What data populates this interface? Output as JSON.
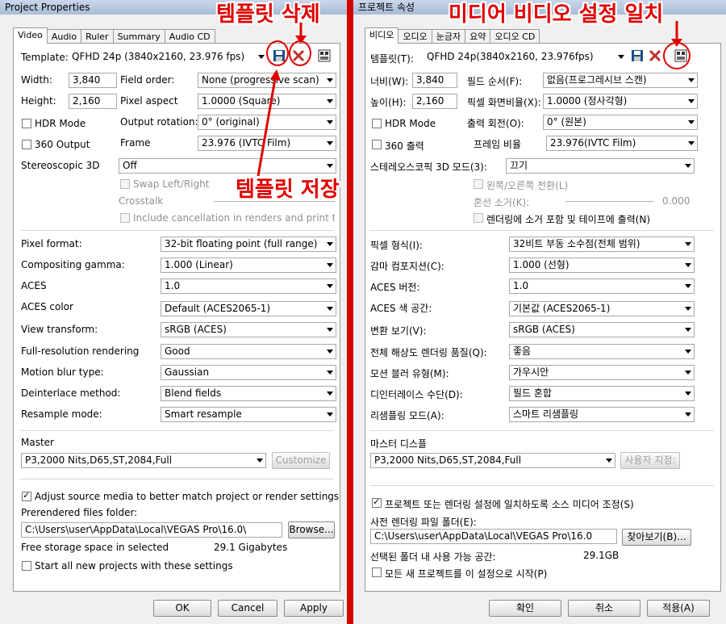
{
  "left": {
    "title": "Project Properties",
    "tabs": [
      "Video",
      "Audio",
      "Ruler",
      "Summary",
      "Audio CD"
    ],
    "template": {
      "label": "Template:",
      "value": "QFHD 24p (3840x2160, 23.976 fps)"
    },
    "width": {
      "label": "Width:",
      "value": "3,840"
    },
    "height": {
      "label": "Height:",
      "value": "2,160"
    },
    "field_order": {
      "label": "Field order:",
      "value": "None (progressive scan)"
    },
    "pixel_aspect": {
      "label": "Pixel aspect",
      "value": "1.0000 (Square)"
    },
    "output_rotation": {
      "label": "Output rotation:",
      "value": "0° (original)"
    },
    "hdr": "HDR Mode",
    "three60": "360 Output",
    "frame": {
      "label": "Frame",
      "value": "23.976 (IVTC Film)"
    },
    "stereo": {
      "label": "Stereoscopic 3D",
      "value": "Off"
    },
    "swap": "Swap Left/Right",
    "crosstalk": "Crosstalk",
    "include_cancel": "Include cancellation in renders and print to ta",
    "pixel_format": {
      "label": "Pixel format:",
      "value": "32-bit floating point (full range)"
    },
    "compositing": {
      "label": "Compositing gamma:",
      "value": "1.000 (Linear)"
    },
    "aces": {
      "label": "ACES",
      "value": "1.0"
    },
    "aces_color": {
      "label": "ACES color",
      "value": "Default (ACES2065-1)"
    },
    "view_transform": {
      "label": "View transform:",
      "value": "sRGB (ACES)"
    },
    "full_res": {
      "label": "Full-resolution rendering",
      "value": "Good"
    },
    "motion_blur": {
      "label": "Motion blur type:",
      "value": "Gaussian"
    },
    "deinterlace": {
      "label": "Deinterlace method:",
      "value": "Blend fields"
    },
    "resample": {
      "label": "Resample mode:",
      "value": "Smart resample"
    },
    "master": {
      "label": "Master",
      "value": "P3,2000 Nits,D65,ST,2084,Full",
      "customize": "Customize"
    },
    "adjust": "Adjust source media to better match project or render settings",
    "prerendered": {
      "label": "Prerendered files folder:",
      "value": "C:\\Users\\user\\AppData\\Local\\VEGAS Pro\\16.0\\",
      "browse": "Browse..."
    },
    "free_space": {
      "label": "Free storage space in selected",
      "value": "29.1 Gigabytes"
    },
    "start_all": "Start all new projects with these settings",
    "ok": "OK",
    "cancel": "Cancel",
    "apply": "Apply"
  },
  "right": {
    "title": "프로젝트 속성",
    "tabs": [
      "비디오",
      "오디오",
      "눈금자",
      "요약",
      "오디오 CD"
    ],
    "template": {
      "label": "템플릿(T):",
      "value": "QFHD 24p(3840x2160, 23.976fps)"
    },
    "width": {
      "label": "너비(W):",
      "value": "3,840"
    },
    "height": {
      "label": "높이(H):",
      "value": "2,160"
    },
    "field_order": {
      "label": "필드 순서(F):",
      "value": "없음(프로그레시브 스캔)"
    },
    "pixel_aspect": {
      "label": "픽셀 화면비율(X):",
      "value": "1.0000 (정사각형)"
    },
    "output_rotation": {
      "label": "출력 회전(O):",
      "value": "0°  (원본)"
    },
    "hdr": "HDR Mode",
    "three60": "360 출력",
    "frame": {
      "label": "프레임 비율",
      "value": "23.976(IVTC Film)"
    },
    "stereo": {
      "label": "스테레오스코픽 3D 모드(3):",
      "value": "끄기"
    },
    "swap": "왼쪽/오른쪽 전환(L)",
    "crosstalk": "혼선 소거(K):",
    "crosstalk_value": "0.000",
    "include_cancel": "렌더링에 소거 포함 및 테이프에 출력(N)",
    "pixel_format": {
      "label": "픽셀 형식(I):",
      "value": "32비트 부동 소수점(전체 범위)"
    },
    "compositing": {
      "label": "감마 컴포지션(C):",
      "value": "1.000 (선형)"
    },
    "aces": {
      "label": "ACES 버전:",
      "value": "1.0"
    },
    "aces_color": {
      "label": "ACES 색 공간:",
      "value": "기본값 (ACES2065-1)"
    },
    "view_transform": {
      "label": "변환 보기(V):",
      "value": "sRGB (ACES)"
    },
    "full_res": {
      "label": "전체 해상도 렌더링 품질(Q):",
      "value": "좋음"
    },
    "motion_blur": {
      "label": "모션 블러 유형(M):",
      "value": "가우시안"
    },
    "deinterlace": {
      "label": "디인터레이스 수단(D):",
      "value": "필드 혼합"
    },
    "resample": {
      "label": "리샘플링 모드(A):",
      "value": "스마트 리샘플링"
    },
    "master": {
      "label": "마스터 디스플",
      "value": "P3,2000 Nits,D65,ST,2084,Full",
      "customize": "사용자 지정:"
    },
    "adjust": "프로젝트 또는 렌더링 설정에 일치하도록 소스 미디어 조정(S)",
    "prerendered": {
      "label": "사전 렌더링 파일 폴더(E):",
      "value": "C:\\Users\\user\\AppData\\Local\\VEGAS Pro\\16.0",
      "browse": "찾아보기(B)..."
    },
    "free_space": {
      "label": "선택된 폴더 내 사용 가능 공간:",
      "value": "29.1GB"
    },
    "start_all": "모든 새 프로젝트를 이 설정으로 시작(P)",
    "ok": "확인",
    "cancel": "취소",
    "apply": "적용(A)"
  },
  "annotations": {
    "delete_template": "템플릿 삭제",
    "save_template": "템플릿 저장",
    "match_media": "미디어 비디오 설정 일치"
  },
  "colors": {
    "annotation": "#e00000",
    "frame_border": "#d40000"
  }
}
